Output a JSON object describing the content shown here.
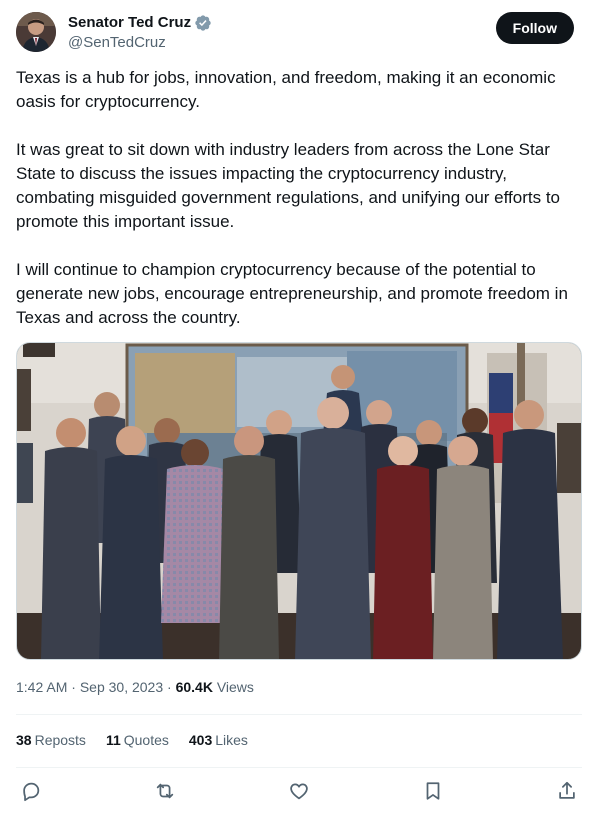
{
  "author": {
    "display_name": "Senator Ted Cruz",
    "handle": "@SenTedCruz",
    "verified_badge": "verified-badge-icon",
    "badge_color": "#829aab"
  },
  "follow_button": {
    "label": "Follow"
  },
  "tweet": {
    "paragraphs": [
      "Texas is a hub for jobs, innovation, and freedom, making it an economic oasis for cryptocurrency.",
      "It was great to sit down with industry leaders from across the Lone Star State to discuss the issues impacting the cryptocurrency industry, combating misguided government regulations,  and unifying our efforts to promote this important issue.",
      "I will continue to champion cryptocurrency because of the potential to generate new jobs, encourage entrepreneurship, and promote freedom in Texas and across the country."
    ]
  },
  "meta": {
    "time": "1:42 AM",
    "sep1": " · ",
    "date": "Sep 30, 2023",
    "sep2": " · ",
    "views_count": "60.4K",
    "views_label": " Views"
  },
  "stats": {
    "reposts": {
      "count": "38",
      "label": "Reposts"
    },
    "quotes": {
      "count": "11",
      "label": "Quotes"
    },
    "likes": {
      "count": "403",
      "label": "Likes"
    }
  },
  "actions": [
    "reply-icon",
    "repost-icon",
    "like-icon",
    "bookmark-icon",
    "share-icon"
  ],
  "colors": {
    "text_primary": "#0f1419",
    "text_secondary": "#536471",
    "follow_bg": "#0f1419",
    "divider": "#eff3f4"
  }
}
